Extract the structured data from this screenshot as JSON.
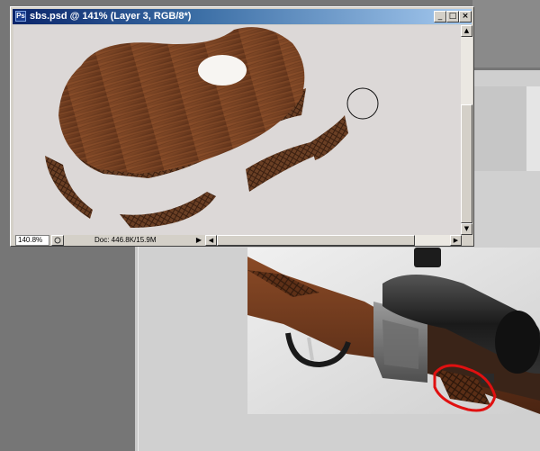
{
  "window": {
    "title": "sbs.psd @ 141% (Layer 3, RGB/8*)",
    "title_icon": "Ps",
    "minimize": "_",
    "maximize": "□",
    "close": "×"
  },
  "status": {
    "zoom": "140.8%",
    "doc_info": "Doc: 446.8K/15.9M",
    "arrow": "▶"
  },
  "scroll": {
    "up": "▲",
    "down": "▼",
    "left": "◀",
    "right": "▶"
  },
  "colors": {
    "title_active": "#0a246a",
    "window_chrome": "#d4d0c8",
    "wood": "#7a4424",
    "annotation_red": "#e01010"
  }
}
